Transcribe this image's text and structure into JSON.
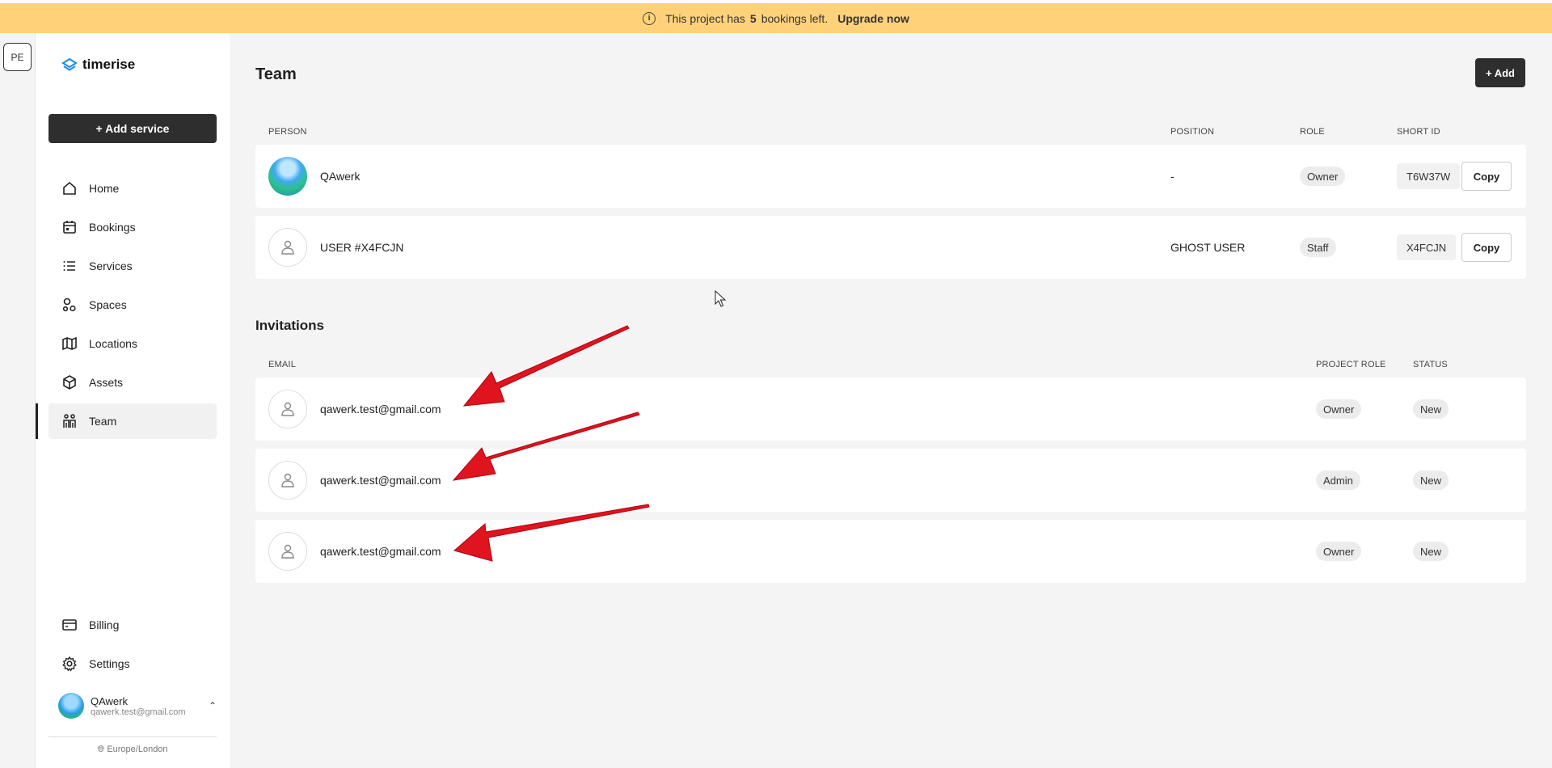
{
  "banner": {
    "text_before": "This project has",
    "count": "5",
    "text_after": "bookings left.",
    "upgrade_label": "Upgrade now"
  },
  "rail": {
    "project_initials": "PE"
  },
  "sidebar": {
    "logo": "timerise",
    "add_service_label": "+ Add service",
    "items": [
      {
        "label": "Home",
        "icon": "home-icon"
      },
      {
        "label": "Bookings",
        "icon": "calendar-icon"
      },
      {
        "label": "Services",
        "icon": "list-icon"
      },
      {
        "label": "Spaces",
        "icon": "spaces-icon"
      },
      {
        "label": "Locations",
        "icon": "map-icon"
      },
      {
        "label": "Assets",
        "icon": "box-icon"
      },
      {
        "label": "Team",
        "icon": "team-icon",
        "active": true
      }
    ],
    "bottom_items": [
      {
        "label": "Billing",
        "icon": "credit-card-icon"
      },
      {
        "label": "Settings",
        "icon": "gear-icon"
      }
    ],
    "user": {
      "name": "QAwerk",
      "email": "qawerk.test@gmail.com"
    },
    "timezone": "Europe/London"
  },
  "main": {
    "title": "Team",
    "add_label": "+ Add",
    "team_columns": {
      "person": "PERSON",
      "position": "POSITION",
      "role": "ROLE",
      "short_id": "SHORT ID"
    },
    "team_rows": [
      {
        "name": "QAwerk",
        "position": "-",
        "role": "Owner",
        "short_id": "T6W37W",
        "copy": "Copy"
      },
      {
        "name": "USER #X4FCJN",
        "position": "GHOST USER",
        "role": "Staff",
        "short_id": "X4FCJN",
        "copy": "Copy"
      }
    ],
    "invitations_title": "Invitations",
    "inv_columns": {
      "email": "EMAIL",
      "project_role": "PROJECT ROLE",
      "status": "STATUS"
    },
    "invitations": [
      {
        "email": "qawerk.test@gmail.com",
        "role": "Owner",
        "status": "New"
      },
      {
        "email": "qawerk.test@gmail.com",
        "role": "Admin",
        "status": "New"
      },
      {
        "email": "qawerk.test@gmail.com",
        "role": "Owner",
        "status": "New"
      }
    ]
  },
  "colors": {
    "banner": "#ffd27a",
    "annotation_arrow": "#e0141e",
    "primary_button": "#2e2e2e"
  }
}
